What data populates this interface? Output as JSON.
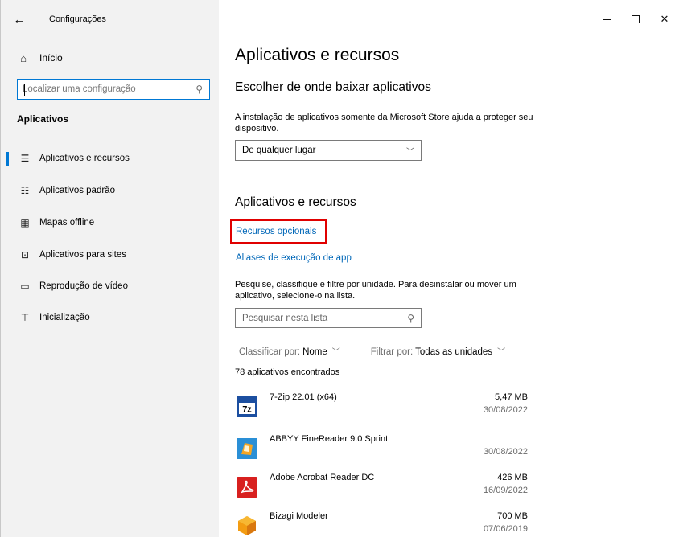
{
  "window": {
    "title": "Configurações",
    "back": "←",
    "controls": {
      "close": "✕"
    }
  },
  "sidebar": {
    "home": {
      "icon": "home-icon",
      "label": "Início"
    },
    "search": {
      "placeholder": "Localizar uma configuração",
      "icon": "search-icon"
    },
    "section": "Aplicativos",
    "items": [
      {
        "label": "Aplicativos e recursos",
        "icon": "list-icon",
        "selected": true
      },
      {
        "label": "Aplicativos padrão",
        "icon": "list-check-icon",
        "selected": false
      },
      {
        "label": "Mapas offline",
        "icon": "map-icon",
        "selected": false
      },
      {
        "label": "Aplicativos para sites",
        "icon": "web-app-icon",
        "selected": false
      },
      {
        "label": "Reprodução de vídeo",
        "icon": "video-icon",
        "selected": false
      },
      {
        "label": "Inicialização",
        "icon": "startup-icon",
        "selected": false
      }
    ]
  },
  "main": {
    "title": "Aplicativos e recursos",
    "choose_heading": "Escolher de onde baixar aplicativos",
    "choose_desc": "A instalação de aplicativos somente da Microsoft Store ajuda a proteger seu dispositivo.",
    "source_dropdown": {
      "value": "De qualquer lugar"
    },
    "apps_heading": "Aplicativos e recursos",
    "link_optional": "Recursos opcionais",
    "link_aliases": "Aliases de execução de app",
    "list_desc": "Pesquise, classifique e filtre por unidade. Para desinstalar ou mover um aplicativo, selecione-o na lista.",
    "list_search": {
      "placeholder": "Pesquisar nesta lista"
    },
    "sort": {
      "label": "Classificar por:",
      "value": "Nome"
    },
    "filter": {
      "label": "Filtrar por:",
      "value": "Todas as unidades"
    },
    "count": "78 aplicativos encontrados",
    "apps": [
      {
        "name": "7-Zip 22.01 (x64)",
        "size": "5,47 MB",
        "date": "30/08/2022",
        "icon": "7zip-icon"
      },
      {
        "name": "ABBYY FineReader 9.0 Sprint",
        "size": "",
        "date": "30/08/2022",
        "icon": "abbyy-icon"
      },
      {
        "name": "Adobe Acrobat Reader DC",
        "size": "426 MB",
        "date": "16/09/2022",
        "icon": "acrobat-icon"
      },
      {
        "name": "Bizagi Modeler",
        "size": "700 MB",
        "date": "07/06/2019",
        "icon": "bizagi-icon"
      }
    ]
  },
  "colors": {
    "accent": "#0078d4",
    "link": "#0067b8",
    "highlight": "#e00000",
    "sidebar_bg": "#f2f2f2"
  }
}
